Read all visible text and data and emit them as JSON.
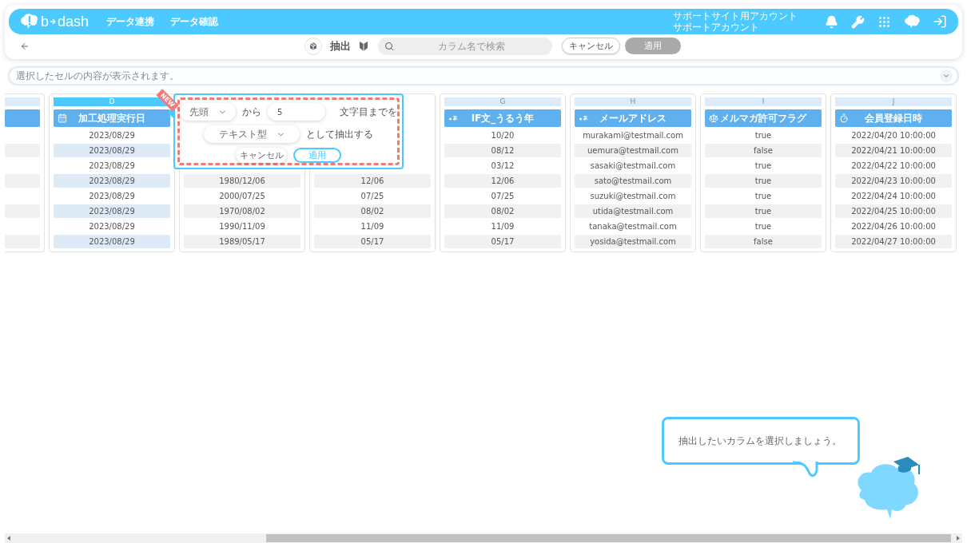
{
  "nav": {
    "logo": [
      "b",
      "dash"
    ],
    "menu": [
      {
        "label": "データ連携"
      },
      {
        "label": "データ確認"
      }
    ],
    "account": [
      "サポートサイト用アカウント",
      "サポートアカウント"
    ]
  },
  "toolbar": {
    "mode": "抽出",
    "search": {
      "placeholder": "カラム名で検索"
    },
    "buttons": [
      {
        "label": "キャンセル",
        "disabled": false
      },
      {
        "label": "適用",
        "disabled": true
      }
    ]
  },
  "cell_preview": {
    "placeholder": "選択したセルの内容が表示されます。"
  },
  "columns": [
    {
      "letter": "D",
      "header": "加工処理実行日",
      "kind": "date",
      "selected": true,
      "badge": "NEW",
      "rows": [
        "2023/08/29",
        "2023/08/29",
        "2023/08/29",
        "2023/08/29",
        "2023/08/29",
        "2023/08/29",
        "2023/08/29",
        "2023/08/29"
      ]
    },
    {
      "rows": [
        "1980/12/06",
        "2000/07/25",
        "1970/08/02",
        "1990/11/09",
        "1989/05/17"
      ]
    },
    {
      "rows": [
        "12/06",
        "07/25",
        "08/02",
        "11/09",
        "05/17"
      ]
    },
    {
      "letter": "G",
      "header": "IF文_うるう年",
      "kind": "text",
      "selected": false,
      "rows": [
        "10/20",
        "08/12",
        "03/12",
        "12/06",
        "07/25",
        "08/02",
        "11/09",
        "05/17"
      ]
    },
    {
      "letter": "H",
      "header": "メールアドレス",
      "kind": "text",
      "selected": false,
      "rows": [
        "murakami@testmail.com",
        "uemura@testmail.com",
        "sasaki@testmail.com",
        "sato@testmail.com",
        "suzuki@testmail.com",
        "utida@testmail.com",
        "tanaka@testmail.com",
        "yosida@testmail.com"
      ]
    },
    {
      "letter": "I",
      "header": "メルマガ許可フラグ",
      "kind": "boolean",
      "selected": false,
      "rows": [
        "true",
        "false",
        "true",
        "true",
        "true",
        "true",
        "true",
        "false"
      ]
    },
    {
      "letter": "J",
      "header": "会員登録日時",
      "kind": "datetime",
      "selected": false,
      "rows": [
        "2022/04/20 10:00:00",
        "2022/04/21 10:00:00",
        "2022/04/22 10:00:00",
        "2022/04/23 10:00:00",
        "2022/04/24 10:00:00",
        "2022/04/25 10:00:00",
        "2022/04/26 10:00:00",
        "2022/04/27 10:00:00"
      ]
    }
  ],
  "popover": {
    "position_select": "先頭",
    "from_label": "から",
    "count": "5",
    "count_suffix": "文字目までを",
    "type_select": "テキスト型",
    "extract_label": "として抽出する",
    "buttons": [
      {
        "label": "キャンセル",
        "kind": "secondary"
      },
      {
        "label": "適用",
        "kind": "primary"
      }
    ]
  },
  "hint": {
    "message": "抽出したいカラムを選択しましょう。"
  }
}
